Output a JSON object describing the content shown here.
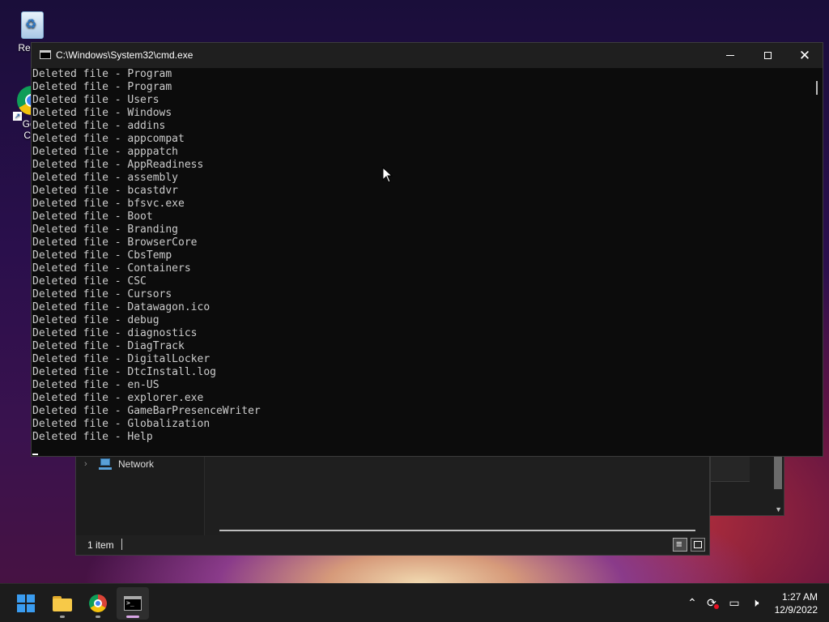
{
  "desktop": {
    "recycle_label": "Recyc",
    "chrome_label_1": "Goo",
    "chrome_label_2": "Chr"
  },
  "explorer": {
    "nav_item": "Network",
    "status_count": "1 item"
  },
  "cmd": {
    "title": "C:\\Windows\\System32\\cmd.exe",
    "lines": [
      "Deleted file - Program",
      "Deleted file - Program",
      "Deleted file - Users",
      "Deleted file - Windows",
      "Deleted file - addins",
      "Deleted file - appcompat",
      "Deleted file - apppatch",
      "Deleted file - AppReadiness",
      "Deleted file - assembly",
      "Deleted file - bcastdvr",
      "Deleted file - bfsvc.exe",
      "Deleted file - Boot",
      "Deleted file - Branding",
      "Deleted file - BrowserCore",
      "Deleted file - CbsTemp",
      "Deleted file - Containers",
      "Deleted file - CSC",
      "Deleted file - Cursors",
      "Deleted file - Datawagon.ico",
      "Deleted file - debug",
      "Deleted file - diagnostics",
      "Deleted file - DiagTrack",
      "Deleted file - DigitalLocker",
      "Deleted file - DtcInstall.log",
      "Deleted file - en-US",
      "Deleted file - explorer.exe",
      "Deleted file - GameBarPresenceWriter",
      "Deleted file - Globalization",
      "Deleted file - Help"
    ]
  },
  "taskbar": {
    "apps": [
      "windows-start",
      "file-explorer",
      "google-chrome",
      "command-prompt"
    ],
    "time": "1:27 AM",
    "date": "12/9/2022",
    "tray_icons": [
      "chevron-up-icon",
      "sync-error-icon",
      "network-icon",
      "volume-muted-icon"
    ]
  }
}
